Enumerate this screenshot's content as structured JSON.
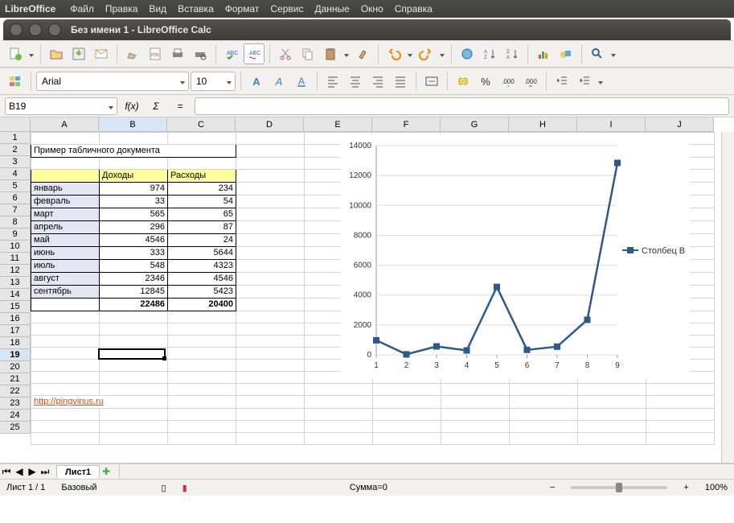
{
  "app_name": "LibreOffice",
  "menubar": [
    "Файл",
    "Правка",
    "Вид",
    "Вставка",
    "Формат",
    "Сервис",
    "Данные",
    "Окно",
    "Справка"
  ],
  "window_title": "Без имени 1 - LibreOffice Calc",
  "font_name": "Arial",
  "font_size": "10",
  "cell_reference": "B19",
  "formula_value": "",
  "columns": [
    "A",
    "B",
    "C",
    "D",
    "E",
    "F",
    "G",
    "H",
    "I",
    "J"
  ],
  "selected_col": "B",
  "row_count": 25,
  "selected_row": 19,
  "title_text": "Пример табличного документа",
  "headers": {
    "income": "Доходы",
    "expense": "Расходы"
  },
  "rows": [
    {
      "m": "январь",
      "i": 974,
      "e": 234
    },
    {
      "m": "февраль",
      "i": 33,
      "e": 54
    },
    {
      "m": "март",
      "i": 565,
      "e": 65
    },
    {
      "m": "апрель",
      "i": 296,
      "e": 87
    },
    {
      "m": "май",
      "i": 4546,
      "e": 24
    },
    {
      "m": "июнь",
      "i": 333,
      "e": 5644
    },
    {
      "m": "июль",
      "i": 548,
      "e": 4323
    },
    {
      "m": "август",
      "i": 2346,
      "e": 4546
    },
    {
      "m": "сентябрь",
      "i": 12845,
      "e": 5423
    }
  ],
  "totals": {
    "income": 22486,
    "expense": 20400
  },
  "link_text": "http://pingvinus.ru",
  "sheet_tab": "Лист1",
  "status": {
    "sheet": "Лист 1 / 1",
    "style": "Базовый",
    "sum": "Сумма=0",
    "zoom": "100%"
  },
  "chart_data": {
    "type": "line",
    "x": [
      1,
      2,
      3,
      4,
      5,
      6,
      7,
      8,
      9
    ],
    "series": [
      {
        "name": "Столбец B",
        "values": [
          974,
          33,
          565,
          296,
          4546,
          333,
          548,
          2346,
          12845
        ]
      }
    ],
    "ylim": [
      0,
      14000
    ],
    "yticks": [
      0,
      2000,
      4000,
      6000,
      8000,
      10000,
      12000,
      14000
    ],
    "xlabel": "",
    "ylabel": "",
    "title": ""
  }
}
